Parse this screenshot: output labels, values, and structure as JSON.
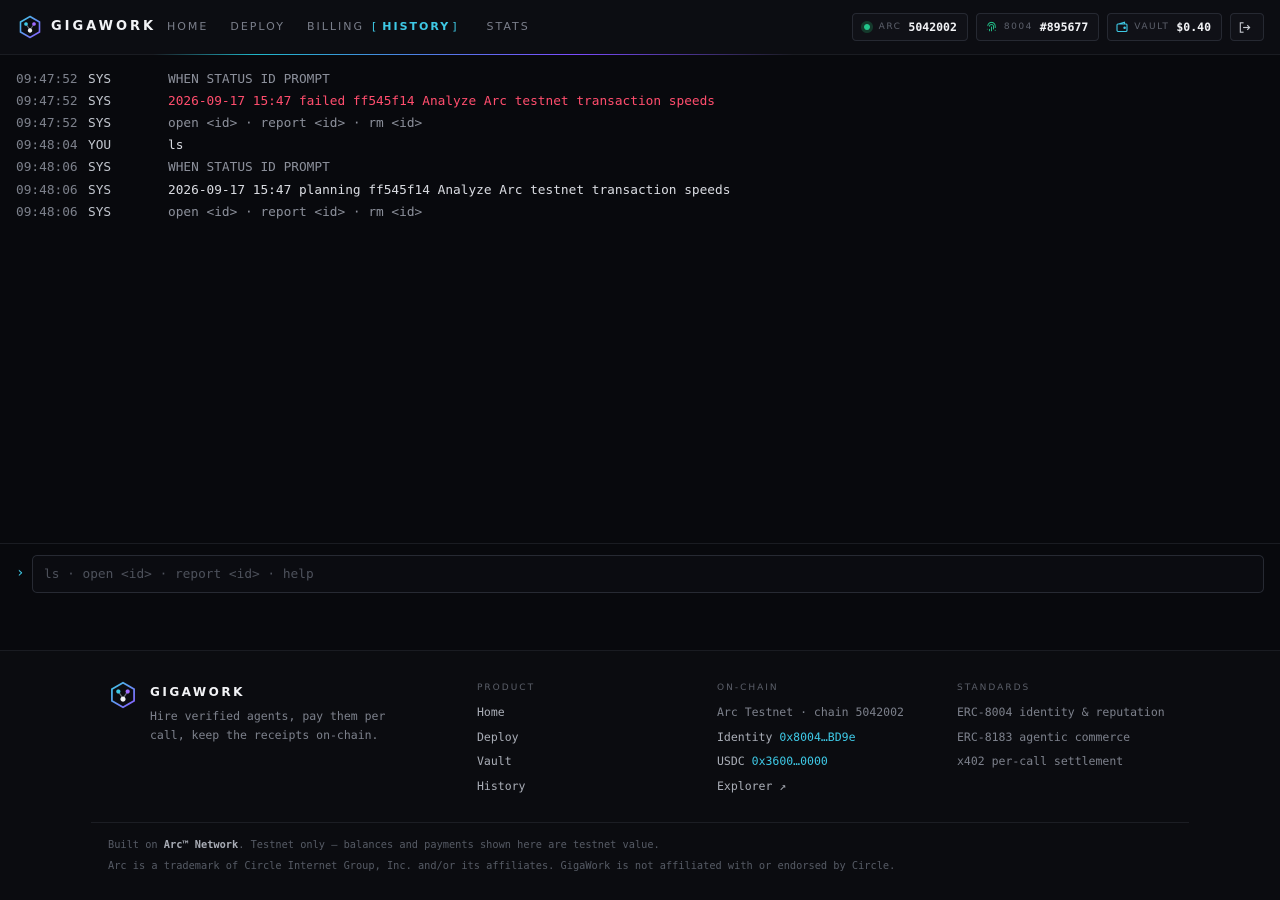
{
  "header": {
    "brand": "GIGAWORK",
    "nav": [
      {
        "label": "HOME",
        "active": false
      },
      {
        "label": "DEPLOY",
        "active": false
      },
      {
        "label": "BILLING",
        "active": false
      },
      {
        "label": "HISTORY",
        "active": true
      },
      {
        "label": "STATS",
        "active": false
      }
    ],
    "active_bracket_left": "[",
    "active_bracket_right": "]",
    "chips": {
      "arc": {
        "label": "ARC",
        "value": "5042002",
        "icon": "status-dot-icon"
      },
      "identity": {
        "label": "8004",
        "value": "#895677",
        "icon": "fingerprint-icon"
      },
      "vault": {
        "label": "VAULT",
        "value": "$0.40",
        "icon": "wallet-icon"
      },
      "logout": {
        "icon": "logout-icon"
      }
    }
  },
  "log": [
    {
      "time": "09:47:52",
      "source": "SYS",
      "message": "WHEN STATUS ID PROMPT",
      "tone": "dim"
    },
    {
      "time": "09:47:52",
      "source": "SYS",
      "message": "2026-09-17 15:47 failed ff545f14 Analyze Arc testnet transaction speeds",
      "tone": "error"
    },
    {
      "time": "09:47:52",
      "source": "SYS",
      "message": "open <id> · report <id> · rm <id>",
      "tone": "dim"
    },
    {
      "time": "09:48:04",
      "source": "YOU",
      "message": "ls",
      "tone": "bright"
    },
    {
      "time": "09:48:06",
      "source": "SYS",
      "message": "WHEN STATUS ID PROMPT",
      "tone": "dim"
    },
    {
      "time": "09:48:06",
      "source": "SYS",
      "message": "2026-09-17 15:47 planning ff545f14 Analyze Arc testnet transaction speeds",
      "tone": "bright"
    },
    {
      "time": "09:48:06",
      "source": "SYS",
      "message": "open <id> · report <id> · rm <id>",
      "tone": "dim"
    }
  ],
  "command": {
    "prompt": "›",
    "value": "",
    "placeholder": "ls · open <id> · report <id> · help"
  },
  "footer": {
    "brand": "GIGAWORK",
    "tagline": "Hire verified agents, pay them per call, keep the receipts on-chain.",
    "product": {
      "title": "PRODUCT",
      "links": [
        "Home",
        "Deploy",
        "Vault",
        "History"
      ]
    },
    "onchain": {
      "title": "ON-CHAIN",
      "network": "Arc Testnet · chain 5042002",
      "identity_label": "Identity",
      "identity_addr": "0x8004…BD9e",
      "usdc_label": "USDC",
      "usdc_addr": "0x3600…0000",
      "explorer": "Explorer ↗"
    },
    "standards": {
      "title": "STANDARDS",
      "items": [
        "ERC-8004 identity & reputation",
        "ERC-8183 agentic commerce",
        "x402 per-call settlement"
      ]
    },
    "legal_prefix": "Built on ",
    "legal_network": "Arc™ Network",
    "legal_suffix": ". Testnet only — balances and payments shown here are testnet value.",
    "trademark": "Arc is a trademark of Circle Internet Group, Inc. and/or its affiliates. GigaWork is not affiliated with or endorsed by Circle."
  },
  "colors": {
    "accent": "#3ec9e6",
    "error": "#ff4d6d",
    "status_ok": "#22c58b",
    "violet": "#7b4cff"
  }
}
